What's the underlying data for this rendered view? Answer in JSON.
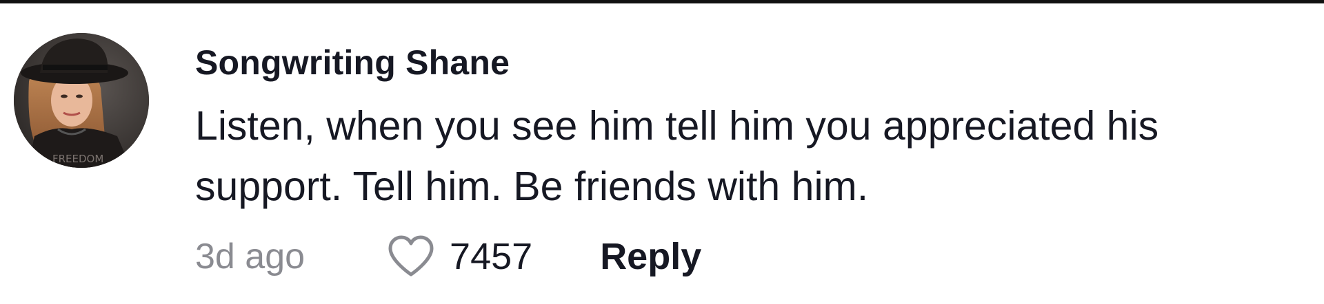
{
  "comment": {
    "username": "Songwriting Shane",
    "text": "Listen, when you see him tell him you appreciated his support. Tell him. Be friends with him.",
    "timestamp": "3d ago",
    "likes": "7457",
    "reply_label": "Reply",
    "avatar_text": "FREEDOM",
    "icons": {
      "like": "heart-outline-icon"
    },
    "colors": {
      "text": "#161823",
      "muted": "#8a8b91"
    }
  }
}
